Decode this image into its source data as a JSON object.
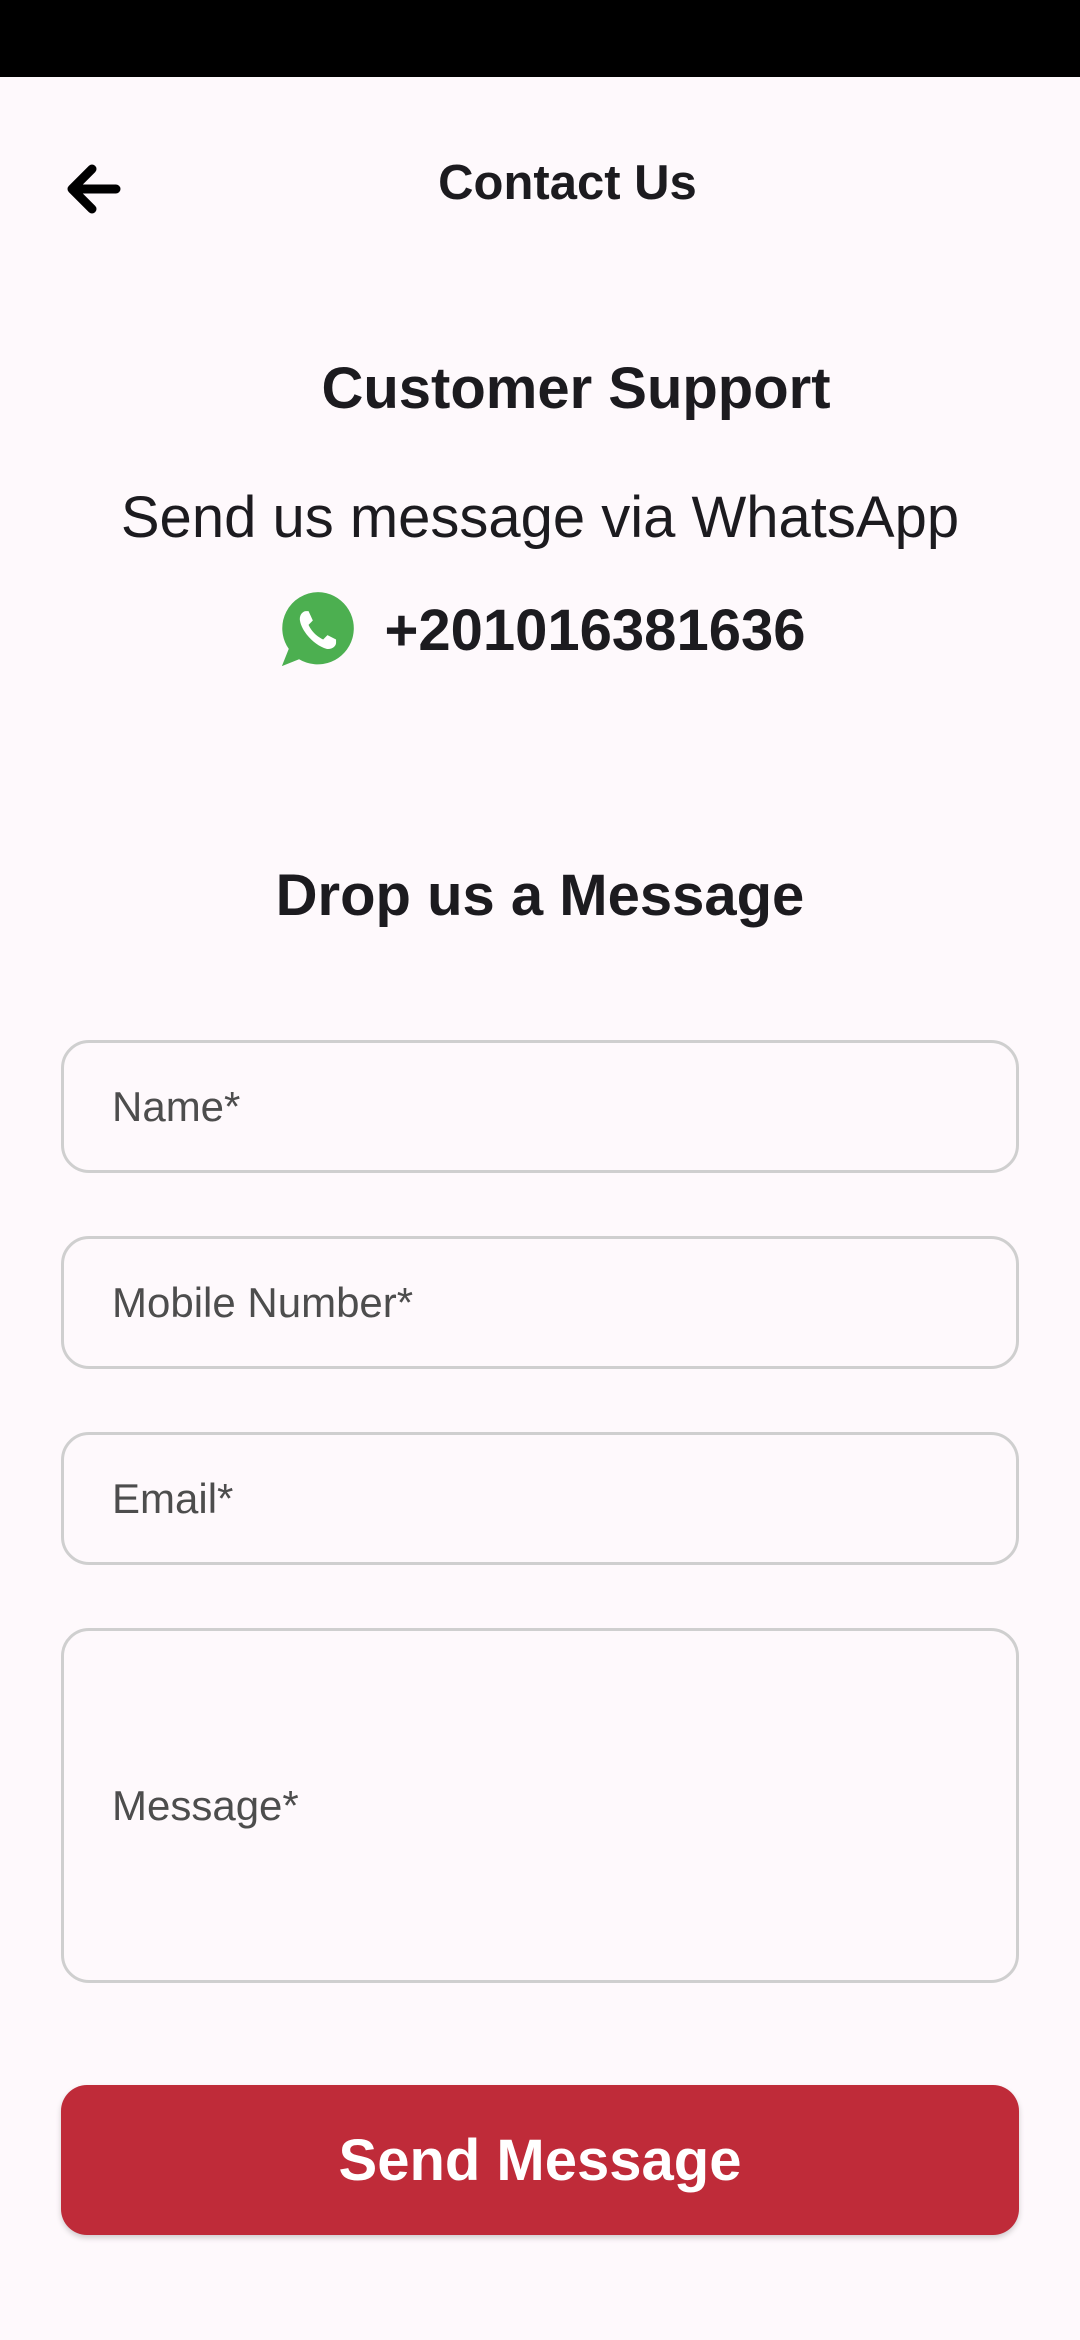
{
  "header": {
    "back_icon": "arrow-left-icon",
    "title": "Contact Us"
  },
  "support": {
    "title": "Customer Support",
    "subtitle": "Send us message via WhatsApp",
    "whatsapp_icon": "whatsapp-icon",
    "whatsapp_number": "+201016381636"
  },
  "form": {
    "title": "Drop us a Message",
    "name_placeholder": "Name*",
    "mobile_placeholder": "Mobile Number*",
    "email_placeholder": "Email*",
    "message_placeholder": "Message*",
    "submit_label": "Send Message"
  },
  "colors": {
    "background": "#FEF9FC",
    "primary_button": "#BF2B39",
    "whatsapp_green": "#4CAF50",
    "status_bar": "#000000"
  }
}
